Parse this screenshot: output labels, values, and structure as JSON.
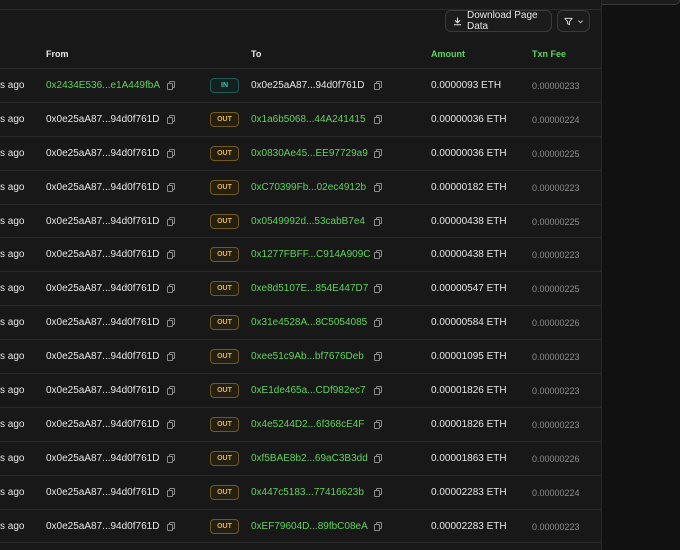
{
  "toolbar": {
    "download_label": "Download Page Data"
  },
  "columns": {
    "from": "From",
    "to": "To",
    "amount": "Amount",
    "fee": "Txn Fee"
  },
  "rows": [
    {
      "age": "s ago",
      "from": "0x2434E536...e1A449fbA",
      "from_green": true,
      "dir": "IN",
      "to": "0x0e25aA87...94d0f761D",
      "to_green": false,
      "amount": "0.0000093 ETH",
      "fee": "0.00000233"
    },
    {
      "age": "s ago",
      "from": "0x0e25aA87...94d0f761D",
      "from_green": false,
      "dir": "OUT",
      "to": "0x1a6b5068...44A241415",
      "to_green": true,
      "amount": "0.00000036 ETH",
      "fee": "0.00000224"
    },
    {
      "age": "s ago",
      "from": "0x0e25aA87...94d0f761D",
      "from_green": false,
      "dir": "OUT",
      "to": "0x0830Ae45...EE97729a9",
      "to_green": true,
      "amount": "0.00000036 ETH",
      "fee": "0.00000225"
    },
    {
      "age": "s ago",
      "from": "0x0e25aA87...94d0f761D",
      "from_green": false,
      "dir": "OUT",
      "to": "0xC70399Fb...02ec4912b",
      "to_green": true,
      "amount": "0.00000182 ETH",
      "fee": "0.00000223"
    },
    {
      "age": "s ago",
      "from": "0x0e25aA87...94d0f761D",
      "from_green": false,
      "dir": "OUT",
      "to": "0x0549992d...53cabB7e4",
      "to_green": true,
      "amount": "0.00000438 ETH",
      "fee": "0.00000225"
    },
    {
      "age": "s ago",
      "from": "0x0e25aA87...94d0f761D",
      "from_green": false,
      "dir": "OUT",
      "to": "0x1277FBFF...C914A909C",
      "to_green": true,
      "amount": "0.00000438 ETH",
      "fee": "0.00000223"
    },
    {
      "age": "s ago",
      "from": "0x0e25aA87...94d0f761D",
      "from_green": false,
      "dir": "OUT",
      "to": "0xe8d5107E...854E447D7",
      "to_green": true,
      "amount": "0.00000547 ETH",
      "fee": "0.00000225"
    },
    {
      "age": "s ago",
      "from": "0x0e25aA87...94d0f761D",
      "from_green": false,
      "dir": "OUT",
      "to": "0x31e4528A...8C5054085",
      "to_green": true,
      "amount": "0.00000584 ETH",
      "fee": "0.00000226"
    },
    {
      "age": "s ago",
      "from": "0x0e25aA87...94d0f761D",
      "from_green": false,
      "dir": "OUT",
      "to": "0xee51c9Ab...bf7676Deb",
      "to_green": true,
      "amount": "0.00001095 ETH",
      "fee": "0.00000223"
    },
    {
      "age": "s ago",
      "from": "0x0e25aA87...94d0f761D",
      "from_green": false,
      "dir": "OUT",
      "to": "0xE1de465a...CDf982ec7",
      "to_green": true,
      "amount": "0.00001826 ETH",
      "fee": "0.00000223"
    },
    {
      "age": "s ago",
      "from": "0x0e25aA87...94d0f761D",
      "from_green": false,
      "dir": "OUT",
      "to": "0x4e5244D2...6f368cE4F",
      "to_green": true,
      "amount": "0.00001826 ETH",
      "fee": "0.00000223"
    },
    {
      "age": "s ago",
      "from": "0x0e25aA87...94d0f761D",
      "from_green": false,
      "dir": "OUT",
      "to": "0xf5BAE8b2...69aC3B3dd",
      "to_green": true,
      "amount": "0.00001863 ETH",
      "fee": "0.00000226"
    },
    {
      "age": "s ago",
      "from": "0x0e25aA87...94d0f761D",
      "from_green": false,
      "dir": "OUT",
      "to": "0x447c5183...77416623b",
      "to_green": true,
      "amount": "0.00002283 ETH",
      "fee": "0.00000224"
    },
    {
      "age": "s ago",
      "from": "0x0e25aA87...94d0f761D",
      "from_green": false,
      "dir": "OUT",
      "to": "0xEF79604D...89fbC08eA",
      "to_green": true,
      "amount": "0.00002283 ETH",
      "fee": "0.00000223"
    }
  ],
  "colors": {
    "green": "#5fd35f",
    "out_badge": "#e0b341",
    "in_badge": "#44c1b4",
    "background": "#181818"
  },
  "icons": {
    "download": "download-icon",
    "filter": "filter-icon",
    "chevron": "chevron-down-icon",
    "copy": "copy-icon"
  }
}
